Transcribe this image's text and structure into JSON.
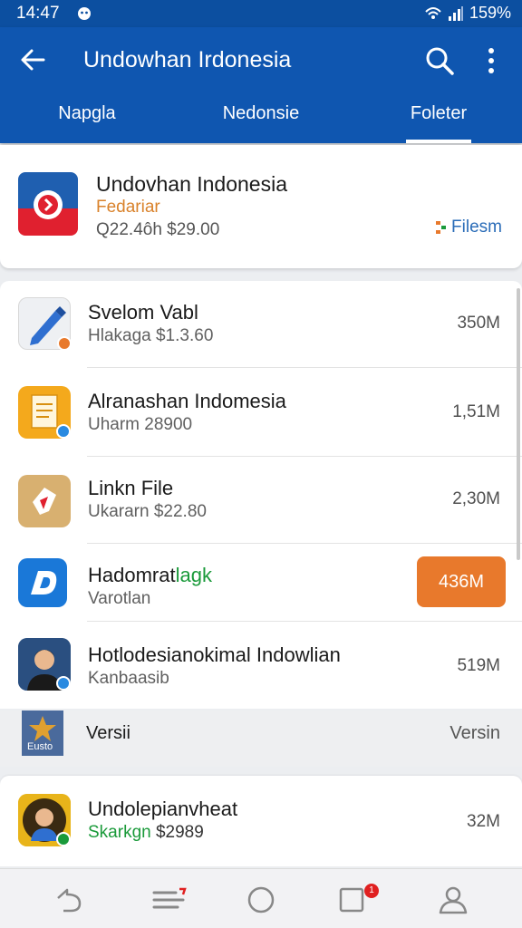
{
  "status": {
    "time": "14:47",
    "battery": "159%"
  },
  "appbar": {
    "title": "Undowhan Irdonesia"
  },
  "tabs": [
    {
      "label": "Napgla"
    },
    {
      "label": "Nedonsie"
    },
    {
      "label": "Foleter"
    }
  ],
  "featured": {
    "title": "Undovhan Indonesia",
    "subtitle": "Fedariar",
    "price": "Q22.4ôh $29.00",
    "action_label": "Filesm"
  },
  "items": [
    {
      "title": "Svelom Vabl",
      "subtitle": "Hlakaga $1.3.60",
      "size": "350M"
    },
    {
      "title": "Alranashan Indomesia",
      "subtitle": "Uharm 28900",
      "size": "1,51M"
    },
    {
      "title": "Linkn File",
      "subtitle": "Ukararn $22.80",
      "size": "2,30M"
    },
    {
      "title_main": "Hadomrat",
      "title_accent": "lagk",
      "subtitle": "Varotlan",
      "size": "436M"
    },
    {
      "title": "Hotlodesianokimal Indowlian",
      "subtitle": "Kanbaasib",
      "size": "519M"
    }
  ],
  "strip": {
    "icon_text": "Eusto",
    "left_label": "Versii",
    "right_label": "Versin"
  },
  "bottom_item": {
    "title": "Undolepianvheat",
    "subtitle_accent": "Skarkgn",
    "subtitle_rest": " $2989",
    "size": "32M"
  },
  "navbar": {
    "tasks_badge": "1"
  },
  "colors": {
    "appbar": "#0f56b0",
    "accent_orange": "#e8792c",
    "accent_green": "#1a9a3a"
  }
}
